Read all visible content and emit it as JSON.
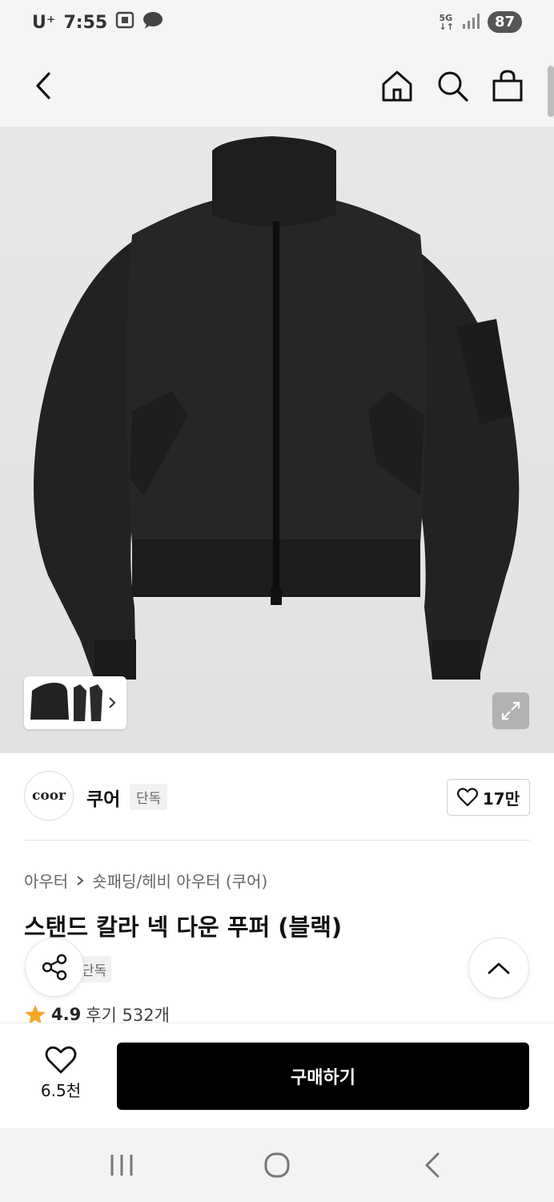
{
  "status_bar": {
    "carrier": "U⁺",
    "time": "7:55",
    "network": "5G",
    "battery": "87"
  },
  "nav": {
    "back_icon": "chevron-left-icon",
    "home_icon": "home-icon",
    "search_icon": "search-icon",
    "cart_icon": "shopping-bag-icon"
  },
  "product": {
    "image_description_icon": "jacket-image",
    "brand": {
      "logo_text": "coor",
      "name": "쿠어",
      "exclusive": "단독"
    },
    "likes": "17만",
    "breadcrumb": [
      "아우터",
      "숏패딩/헤비 아우터 (쿠어)"
    ],
    "title": "스탠드 칼라 넥 다운 푸퍼 (블랙)",
    "exclusive_badge": "단독",
    "rating": "4.9",
    "reviews": "후기 532개"
  },
  "bottom": {
    "wish_count": "6.5천",
    "buy_label": "구매하기"
  },
  "colors": {
    "buy_button": "#000000",
    "star": "#f5a623",
    "page_bg": "#ffffff",
    "header_bg": "#f5f5f5"
  }
}
